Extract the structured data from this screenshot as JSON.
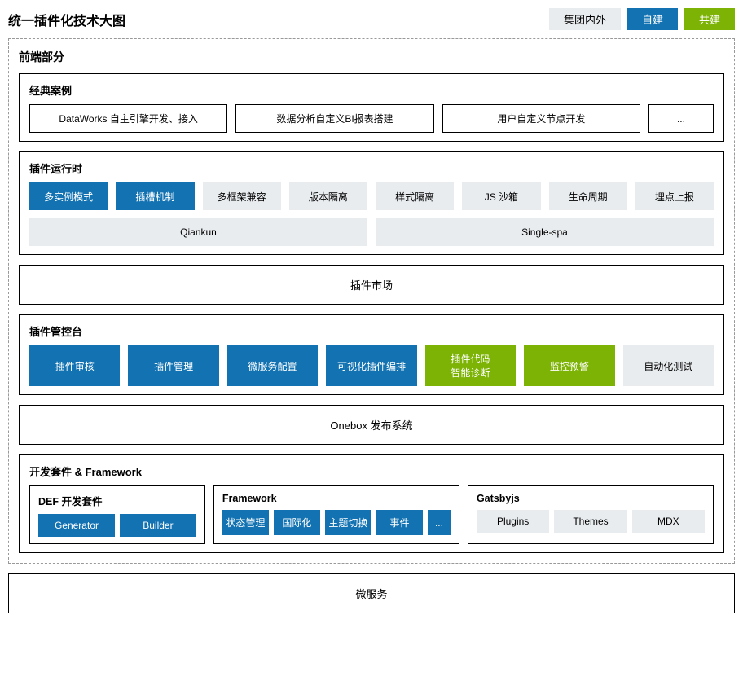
{
  "title": "统一插件化技术大图",
  "legend": {
    "gray": "集团内外",
    "blue": "自建",
    "green": "共建"
  },
  "frontend": {
    "title": "前端部分",
    "cases": {
      "title": "经典案例",
      "items": [
        "DataWorks 自主引擎开发、接入",
        "数据分析自定义BI报表搭建",
        "用户自定义节点开发",
        "..."
      ]
    },
    "runtime": {
      "title": "插件运行时",
      "top": [
        {
          "label": "多实例模式",
          "style": "blue"
        },
        {
          "label": "插槽机制",
          "style": "blue"
        },
        {
          "label": "多框架兼容",
          "style": "gray"
        },
        {
          "label": "版本隔离",
          "style": "gray"
        },
        {
          "label": "样式隔离",
          "style": "gray"
        },
        {
          "label": "JS 沙箱",
          "style": "gray"
        },
        {
          "label": "生命周期",
          "style": "gray"
        },
        {
          "label": "埋点上报",
          "style": "gray"
        }
      ],
      "bottom": [
        {
          "label": "Qiankun",
          "style": "gray"
        },
        {
          "label": "Single-spa",
          "style": "gray"
        }
      ]
    },
    "market": "插件市场",
    "console": {
      "title": "插件管控台",
      "items": [
        {
          "label": "插件审核",
          "style": "blue"
        },
        {
          "label": "插件管理",
          "style": "blue"
        },
        {
          "label": "微服务配置",
          "style": "blue"
        },
        {
          "label": "可视化插件编排",
          "style": "blue"
        },
        {
          "label": "插件代码\n智能诊断",
          "style": "green"
        },
        {
          "label": "监控预警",
          "style": "green"
        },
        {
          "label": "自动化测试",
          "style": "gray"
        }
      ]
    },
    "onebox": "Onebox 发布系统",
    "devkit": {
      "title": "开发套件 & Framework",
      "def": {
        "title": "DEF 开发套件",
        "items": [
          {
            "label": "Generator",
            "style": "blue"
          },
          {
            "label": "Builder",
            "style": "blue"
          }
        ]
      },
      "framework": {
        "title": "Framework",
        "items": [
          {
            "label": "状态管理",
            "style": "blue"
          },
          {
            "label": "国际化",
            "style": "blue"
          },
          {
            "label": "主题切换",
            "style": "blue"
          },
          {
            "label": "事件",
            "style": "blue"
          },
          {
            "label": "...",
            "style": "blue"
          }
        ]
      },
      "gatsby": {
        "title": "Gatsbyjs",
        "items": [
          {
            "label": "Plugins",
            "style": "gray"
          },
          {
            "label": "Themes",
            "style": "gray"
          },
          {
            "label": "MDX",
            "style": "gray"
          }
        ]
      }
    }
  },
  "microservice": "微服务"
}
